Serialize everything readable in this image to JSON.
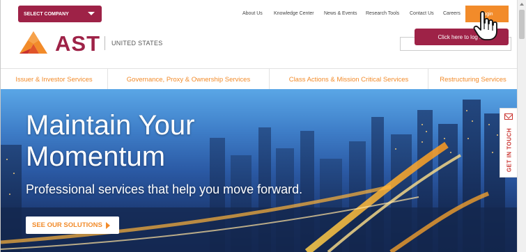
{
  "header": {
    "select_company": "SELECT COMPANY",
    "top_links": [
      "About Us",
      "Knowledge Center",
      "News & Events",
      "Research Tools",
      "Contact Us",
      "Careers"
    ],
    "login": "Login",
    "tooltip": "Click here to log in!"
  },
  "brand": {
    "name": "AST",
    "region": "UNITED STATES",
    "colors": {
      "primary": "#9e2247",
      "accent": "#f28b2a"
    }
  },
  "nav": [
    "Issuer & Investor Services",
    "Governance, Proxy & Ownership Services",
    "Class Actions & Mission Critical Services",
    "Restructuring Services"
  ],
  "hero": {
    "title_line1": "Maintain Your",
    "title_line2": "Momentum",
    "subtitle": "Professional services that help you move forward.",
    "cta": "SEE OUR SOLUTIONS"
  },
  "side_tab": {
    "label": "GET IN TOUCH",
    "icon": "envelope-icon"
  },
  "icons": {
    "cursor": "hand-pointer-icon",
    "caret": "chevron-down-icon"
  }
}
